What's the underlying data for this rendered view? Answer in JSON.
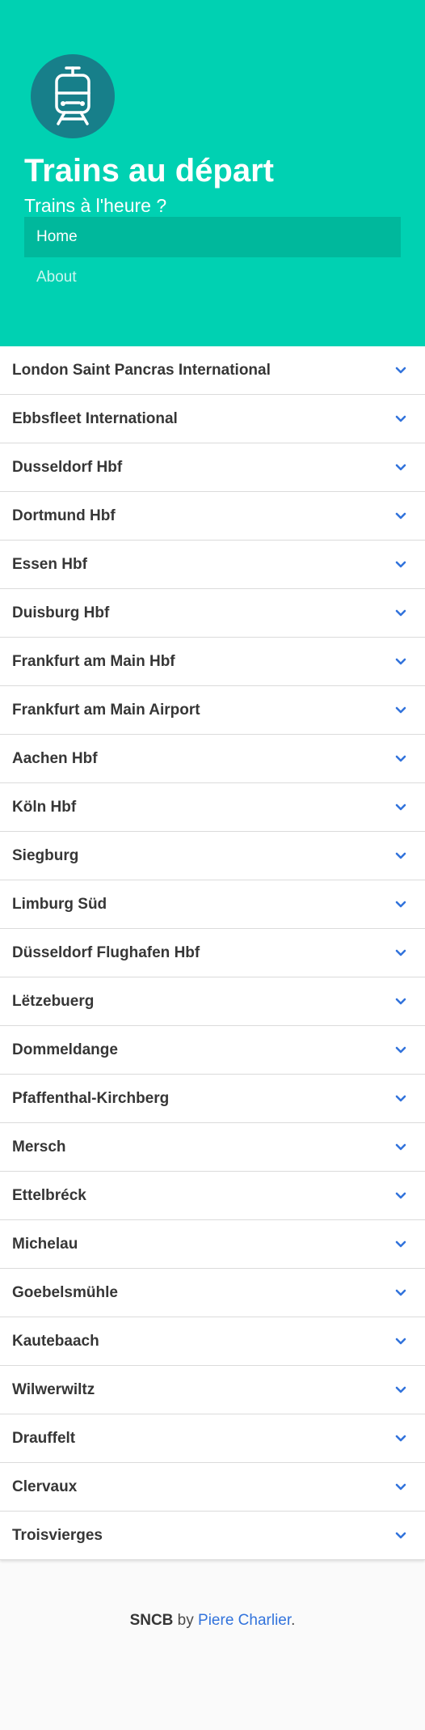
{
  "hero": {
    "title": "Trains au départ",
    "subtitle": "Trains à l'heure ?",
    "logo_icon": "train-icon",
    "bg_color": "#00d1b2",
    "logo_color": "#177f8a"
  },
  "nav": {
    "items": [
      {
        "label": "Home",
        "active": true
      },
      {
        "label": "About",
        "active": false
      }
    ]
  },
  "stations": [
    "London Saint Pancras International",
    "Ebbsfleet International",
    "Dusseldorf Hbf",
    "Dortmund Hbf",
    "Essen Hbf",
    "Duisburg Hbf",
    "Frankfurt am Main Hbf",
    "Frankfurt am Main Airport",
    "Aachen Hbf",
    "Köln Hbf",
    "Siegburg",
    "Limburg Süd",
    "Düsseldorf Flughafen Hbf",
    "Lëtzebuerg",
    "Dommeldange",
    "Pfaffenthal-Kirchberg",
    "Mersch",
    "Ettelbréck",
    "Michelau",
    "Goebelsmühle",
    "Kautebaach",
    "Wilwerwiltz",
    "Drauffelt",
    "Clervaux",
    "Troisvierges"
  ],
  "footer": {
    "brand": "SNCB",
    "by": " by ",
    "author": "Piere Charlier",
    "end": "."
  },
  "accent_color": "#3273dc"
}
